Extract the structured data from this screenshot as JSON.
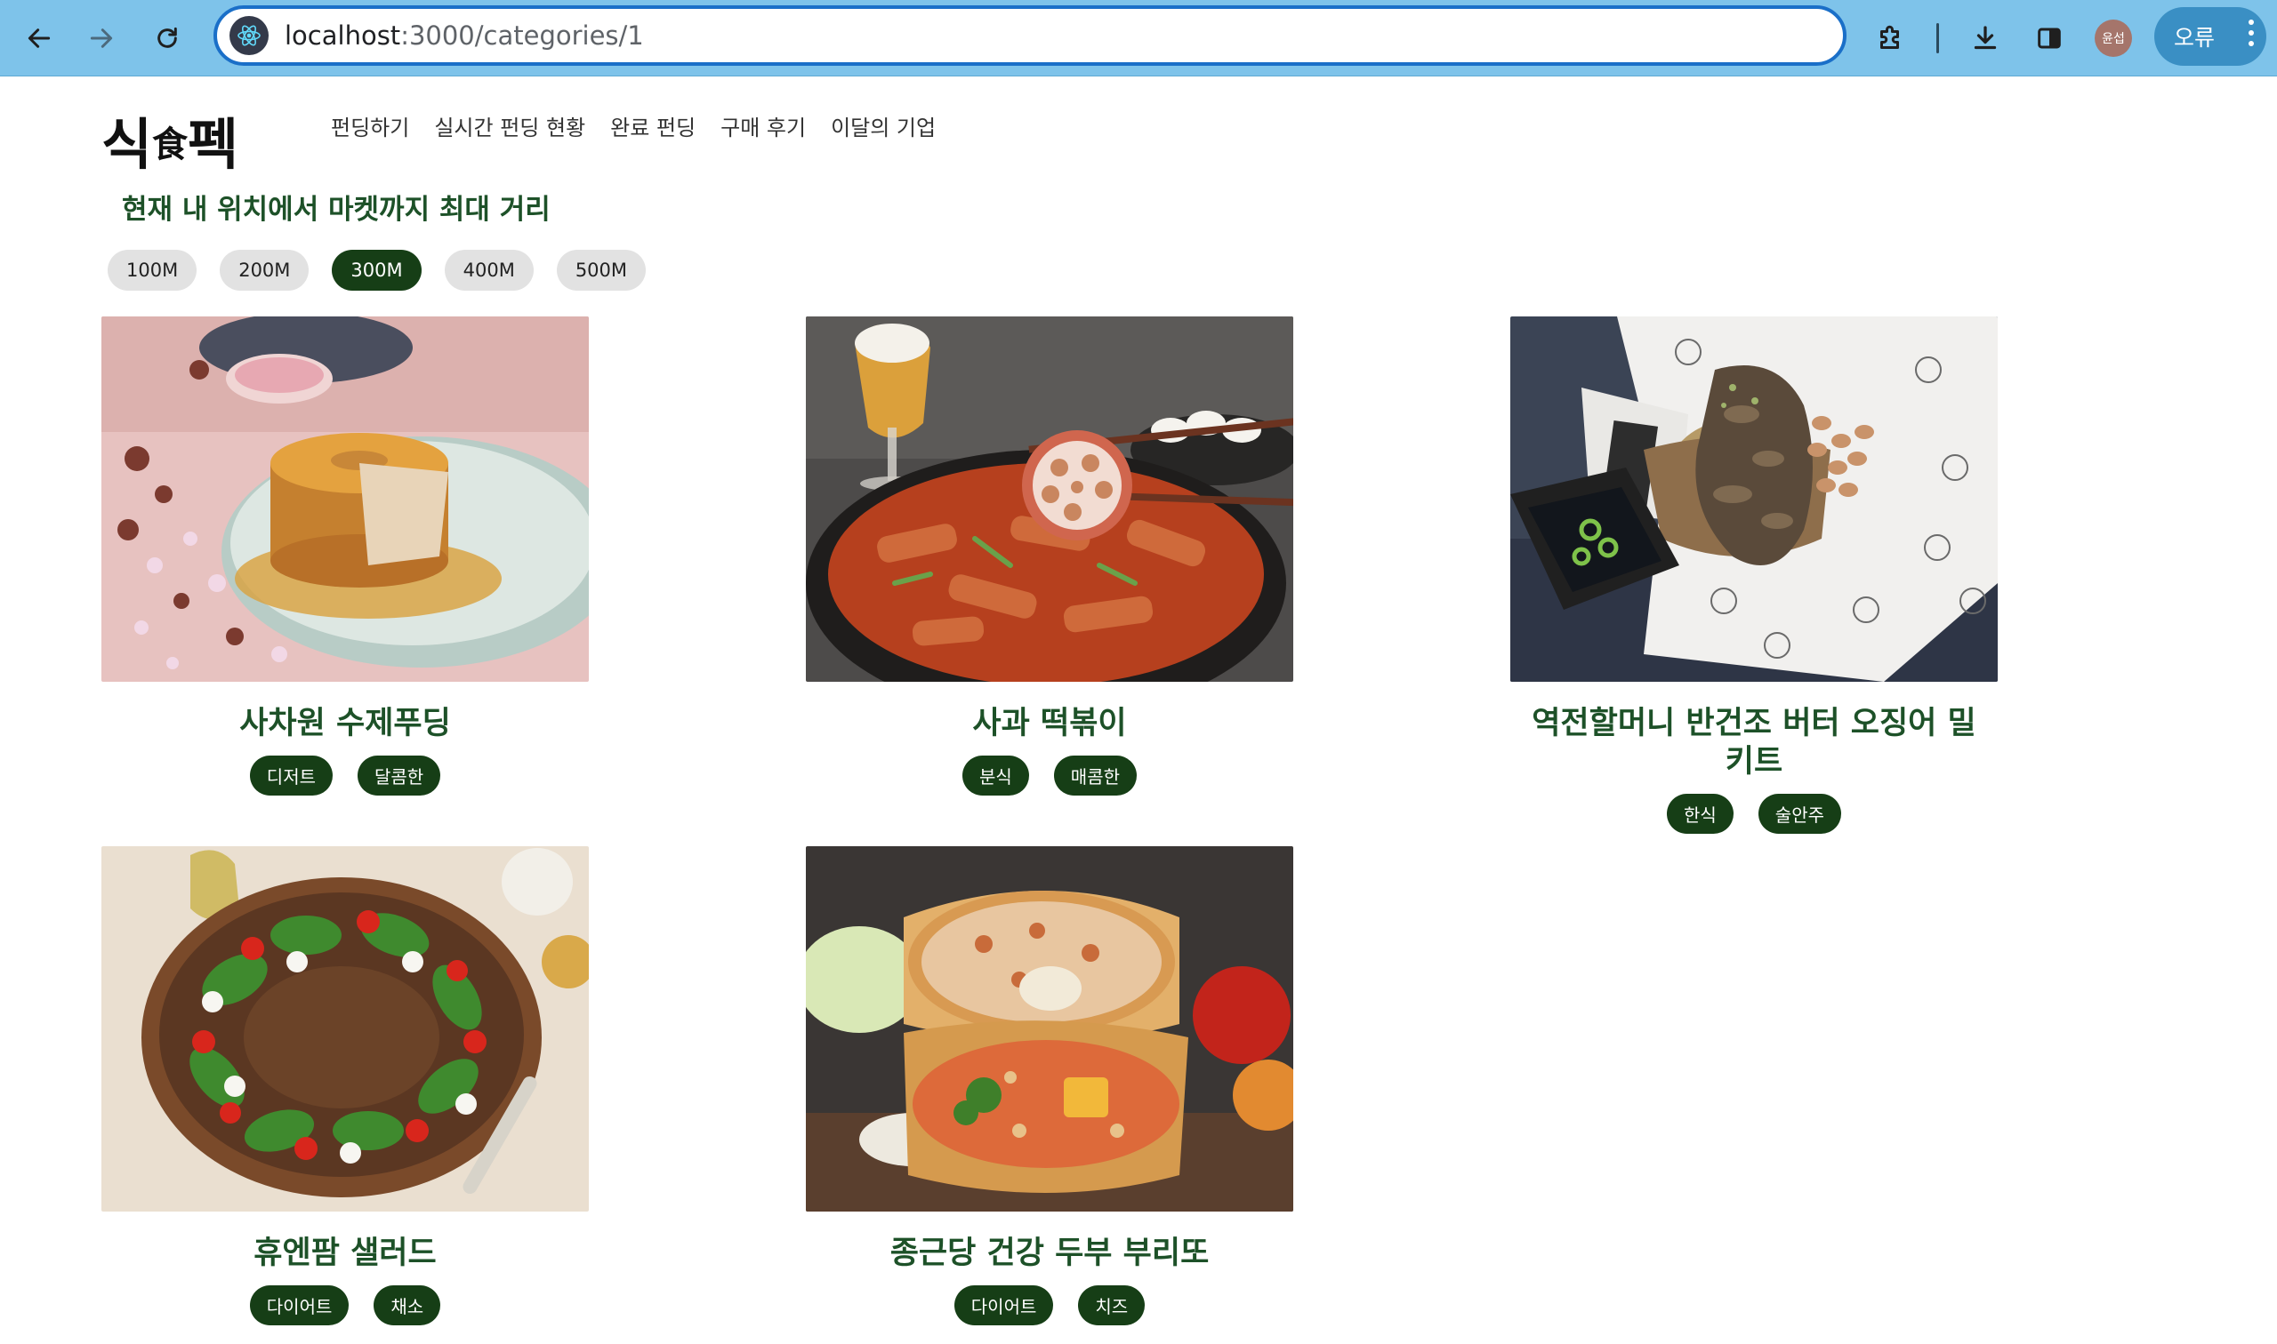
{
  "browser": {
    "url_host": "localhost",
    "url_path": ":3000/categories/1",
    "profile_initials": "윤섭",
    "error_label": "오류",
    "icons": {
      "back": "arrow-left-icon",
      "forward": "arrow-right-icon",
      "reload": "reload-icon",
      "site": "react-logo-icon",
      "extensions": "puzzle-icon",
      "download": "download-icon",
      "sidepanel": "side-panel-icon",
      "menu": "more-vertical-icon"
    }
  },
  "site": {
    "logo_part1": "식",
    "logo_part2": "食",
    "logo_part3": "펙",
    "nav": [
      "펀딩하기",
      "실시간 펀딩 현황",
      "완료 펀딩",
      "구매 후기",
      "이달의 기업"
    ]
  },
  "distance": {
    "title": "현재 내 위치에서 마켓까지 최대 거리",
    "options": [
      "100M",
      "200M",
      "300M",
      "400M",
      "500M"
    ],
    "selected": "300M"
  },
  "products": [
    {
      "name": "사차원 수제푸딩",
      "tags": [
        "디저트",
        "달콤한"
      ]
    },
    {
      "name": "사과 떡볶이",
      "tags": [
        "분식",
        "매콤한"
      ]
    },
    {
      "name": "역전할머니 반건조 버터 오징어 밀키트",
      "tags": [
        "한식",
        "술안주"
      ]
    },
    {
      "name": "휴엔팜 샐러드",
      "tags": [
        "다이어트",
        "채소"
      ]
    },
    {
      "name": "종근당 건강 두부 부리또",
      "tags": [
        "다이어트",
        "치즈"
      ]
    }
  ],
  "colors": {
    "chrome_bg": "#7ec3ea",
    "accent_green": "#1d5128",
    "tag_bg": "#163e16"
  }
}
